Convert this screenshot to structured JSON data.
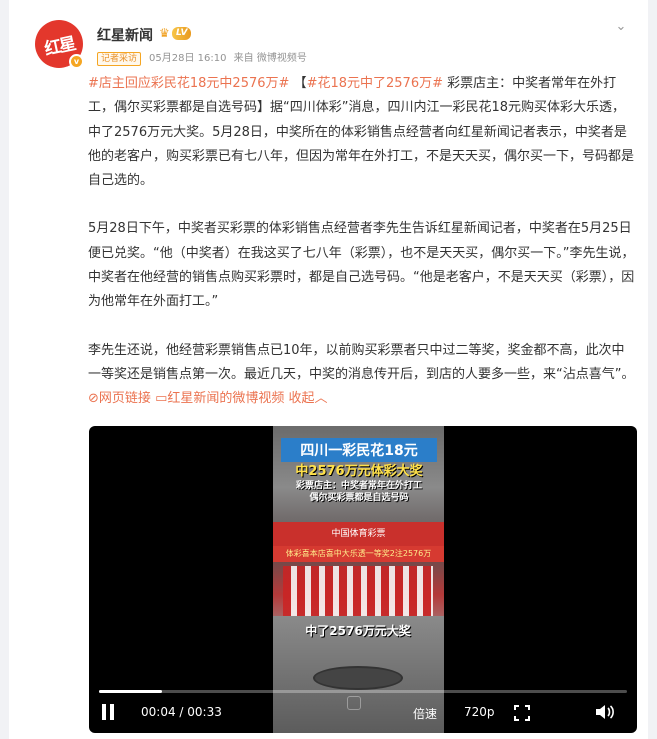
{
  "author": {
    "name": "红星新闻",
    "avatar_text": "红星",
    "level": "LV",
    "tag": "记者采访",
    "date": "05月28日 16:10",
    "source": "来自 微博视频号"
  },
  "post": {
    "hashtag1": "#店主回应彩民花18元中2576万#",
    "hashtag2": "#花18元中了2576万#",
    "p1_rest": " 彩票店主：中奖者常年在外打工，偶尔买彩票都是自选号码】据“四川体彩”消息，四川内江一彩民花18元购买体彩大乐透，中了2576万元大奖。5月28日，中奖所在的体彩销售点经营者向红星新闻记者表示，中奖者是他的老客户，购买彩票已有七八年，但因为常年在外打工，不是天天买，偶尔买一下，号码都是自己选的。",
    "p2": "5月28日下午，中奖者买彩票的体彩销售点经营者李先生告诉红星新闻记者，中奖者在5月25日便已兑奖。“他（中奖者）在我这买了七八年（彩票），也不是天天买，偶尔买一下。”李先生说，中奖者在他经营的销售点购买彩票时，都是自己选号码。“他是老客户，不是天天买（彩票），因为他常年在外面打工。”",
    "p3": "李先生还说，他经营彩票销售点已10年，以前购买彩票者只中过二等奖，奖金都不高，此次中一等奖还是销售点第一次。最近几天，中奖的消息传开后，到店的人要多一些，来“沾点喜气”。",
    "link_web": "网页链接",
    "link_video": "红星新闻的微博视频",
    "collapse": "收起"
  },
  "video": {
    "title_line1": "四川一彩民花18元",
    "title_line2": "中2576万元体彩大奖",
    "subtitle_line1": "彩票店主：中奖者常年在外打工",
    "subtitle_line2": "偶尔买彩票都是自选号码",
    "shop_sign": "中国体育彩票",
    "banner": "体彩喜本店喜中大乐透一等奖2注2576万",
    "caption": "中了2576万元大奖",
    "current_time": "00:04",
    "duration": "00:33",
    "progress": 0.12,
    "speed_label": "倍速",
    "resolution": "720p"
  },
  "colors": {
    "link": "#eb7350",
    "accent": "#f5a623",
    "brand_red": "#e3372c"
  }
}
